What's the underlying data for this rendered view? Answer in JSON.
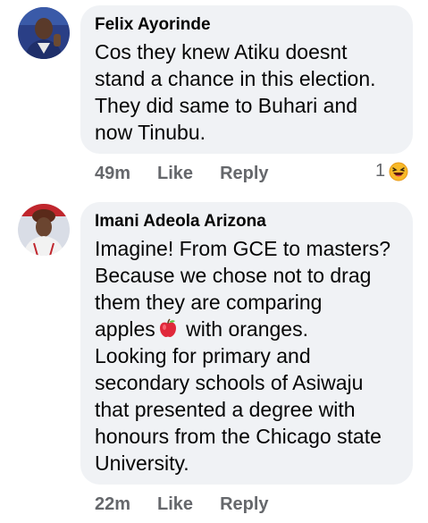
{
  "comments": [
    {
      "author": "Felix Ayorinde",
      "text": "Cos they knew Atiku doesnt\nstand a chance in this election.\nThey did same to Buhari and\nnow Tinubu.",
      "time": "49m",
      "like_label": "Like",
      "reply_label": "Reply",
      "reaction_count": "1",
      "reaction_icon": "laughing-emoji"
    },
    {
      "author": "Imani Adeola Arizona",
      "text_before": "Imagine! From GCE to masters?\nBecause we chose not to drag\nthem they are comparing\napples",
      "inline_icon": "red-apple-emoji",
      "text_after": " with oranges.\nLooking for primary and\nsecondary schools of Asiwaju\nthat presented a degree with\nhonours from the Chicago state\nUniversity.",
      "time": "22m",
      "like_label": "Like",
      "reply_label": "Reply"
    }
  ],
  "colors": {
    "bubble": "#f0f2f5",
    "meta_text": "#65676b",
    "main_text": "#050505"
  }
}
